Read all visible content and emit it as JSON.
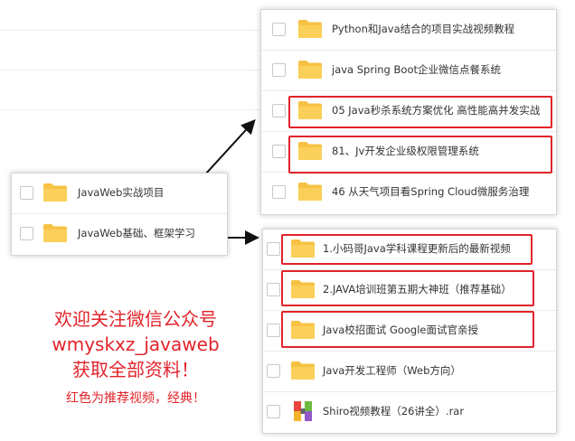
{
  "left_panel": {
    "items": [
      {
        "label": "JavaWeb实战项目",
        "icon": "folder-icon"
      },
      {
        "label": "JavaWeb基础、框架学习",
        "icon": "folder-icon"
      }
    ]
  },
  "top_right_panel": {
    "items": [
      {
        "label": "Python和Java结合的项目实战视频教程",
        "icon": "folder-icon",
        "highlighted": false
      },
      {
        "label": "java Spring Boot企业微信点餐系统",
        "icon": "folder-icon",
        "highlighted": false
      },
      {
        "label": "05 Java秒杀系统方案优化 高性能高并发实战",
        "icon": "folder-icon",
        "highlighted": true
      },
      {
        "label": "81、Jv开发企业级权限管理系统",
        "icon": "folder-icon",
        "highlighted": true
      },
      {
        "label": "46 从天气项目看Spring Cloud微服务治理",
        "icon": "folder-icon",
        "highlighted": false
      }
    ]
  },
  "bottom_right_panel": {
    "items": [
      {
        "label": "1.小码哥Java学科课程更新后的最新视频",
        "icon": "folder-icon",
        "highlighted": true
      },
      {
        "label": "2.JAVA培训班第五期大神班（推荐基础）",
        "icon": "folder-icon",
        "highlighted": true
      },
      {
        "label": "Java校招面试 Google面试官亲授",
        "icon": "folder-icon",
        "highlighted": true
      },
      {
        "label": "Java开发工程师（Web方向）",
        "icon": "folder-icon",
        "highlighted": false
      },
      {
        "label": "Shiro视频教程（26讲全）.rar",
        "icon": "rar-archive-icon",
        "highlighted": false
      }
    ]
  },
  "promo": {
    "line1": "欢迎关注微信公众号",
    "line2": "wmyskxz_javaweb",
    "line3": "获取全部资料！",
    "note": "红色为推荐视频，经典！"
  },
  "colors": {
    "highlight": "#e2232a",
    "folder": "#f7c244",
    "promo_text": "#e2232a"
  }
}
